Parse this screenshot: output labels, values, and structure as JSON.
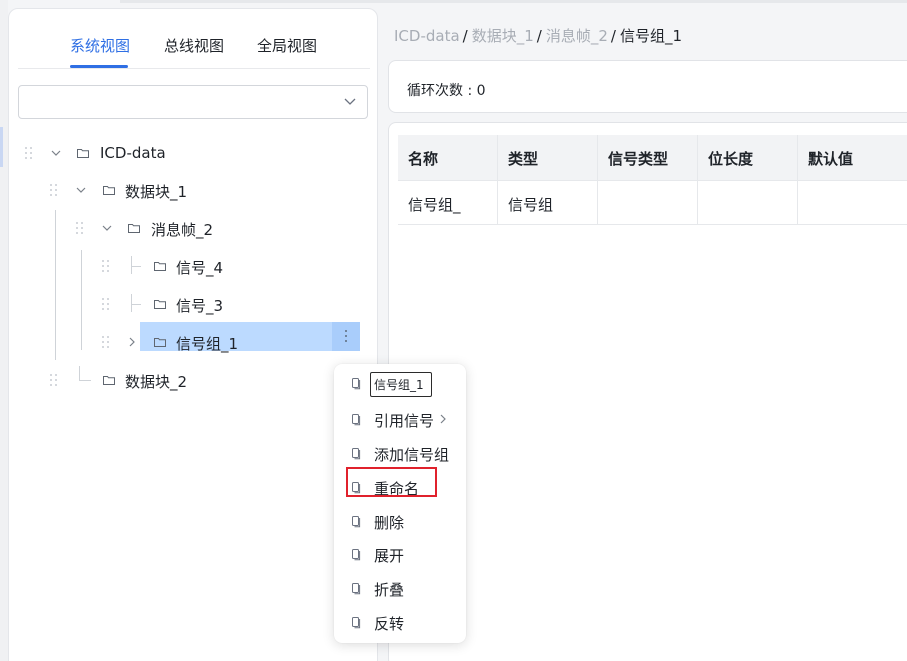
{
  "tabs": {
    "system_view": "系统视图",
    "bus_view": "总线视图",
    "global_view": "全局视图"
  },
  "filter_select": {
    "value": ""
  },
  "tree": {
    "root": "ICD-data",
    "block_1": "数据块_1",
    "frame_2": "消息帧_2",
    "signal_4": "信号_4",
    "signal_3": "信号_3",
    "signal_group_1": "信号组_1",
    "block_2": "数据块_2"
  },
  "breadcrumb": {
    "items": [
      "ICD-data",
      "数据块_1",
      "消息帧_2",
      "信号组_1"
    ],
    "separator": "/"
  },
  "loop_count": "循环次数 : 0",
  "table": {
    "headers": [
      "名称",
      "类型",
      "信号类型",
      "位长度",
      "默认值"
    ],
    "rows": [
      [
        "信号组_",
        "信号组",
        "",
        "",
        ""
      ]
    ]
  },
  "context_menu": {
    "rename_input_value": "信号组_1",
    "items": [
      "引用信号",
      "添加信号组",
      "重命名",
      "删除",
      "展开",
      "折叠",
      "反转"
    ],
    "submenu_arrow": "chevron-right-icon"
  },
  "colors": {
    "accent": "#2f6fe4",
    "selected_row": "#bcdaff",
    "highlight": "#e0212c"
  }
}
